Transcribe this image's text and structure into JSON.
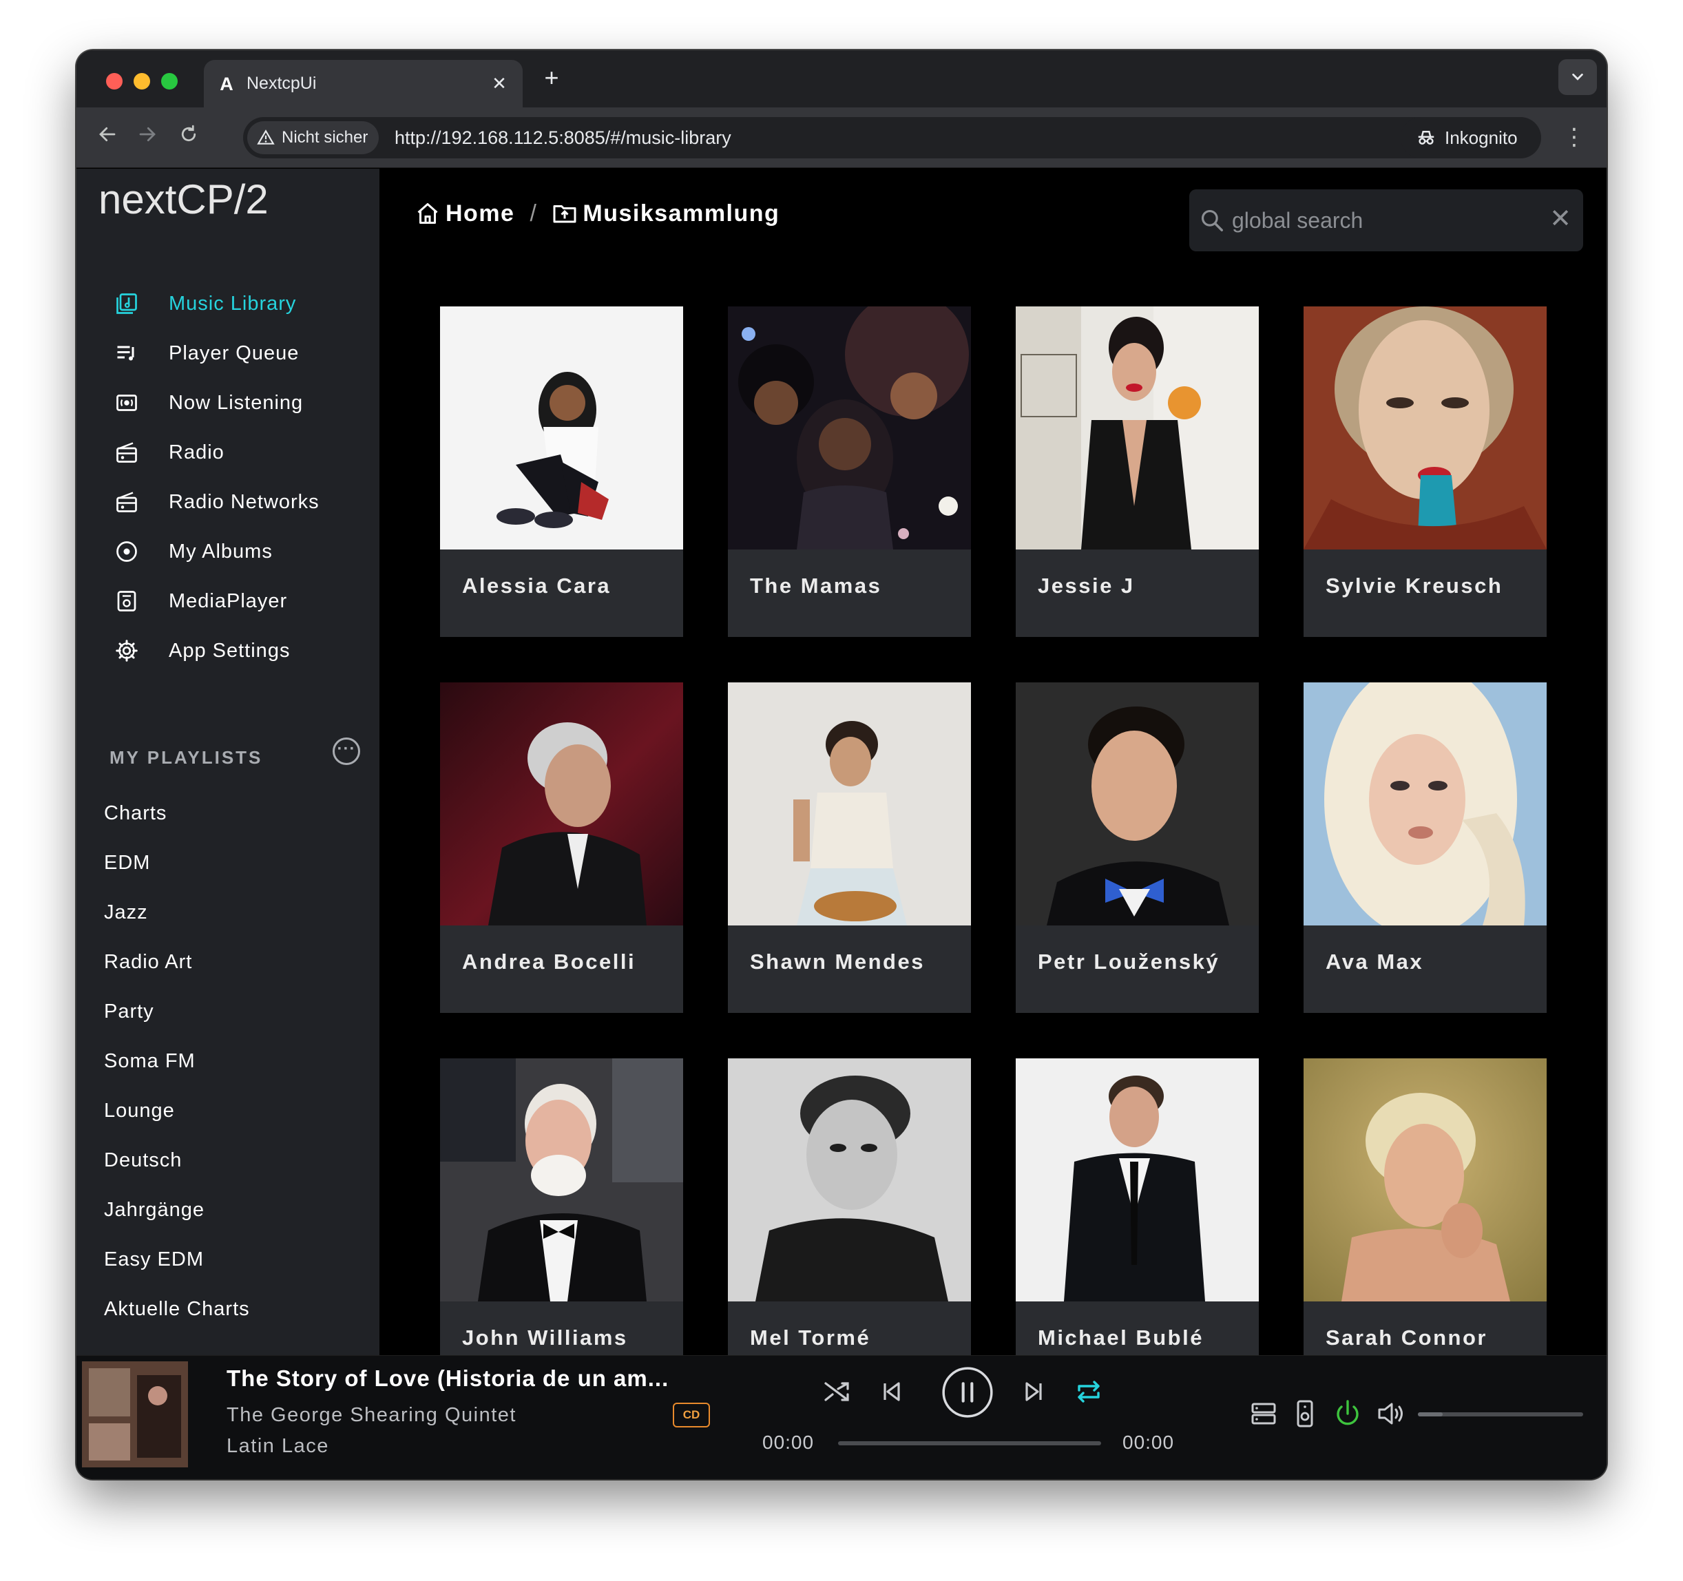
{
  "browser": {
    "tab_title": "NextcpUi",
    "tab_favicon": "A",
    "security_label": "Nicht sicher",
    "url": "http://192.168.112.5:8085/#/music-library",
    "profile_label": "Inkognito"
  },
  "app": {
    "logo": "nextCP/2",
    "nav": [
      {
        "label": "Music Library",
        "icon": "music-library-icon",
        "active": true
      },
      {
        "label": "Player Queue",
        "icon": "queue-icon",
        "active": false
      },
      {
        "label": "Now Listening",
        "icon": "now-listening-icon",
        "active": false
      },
      {
        "label": "Radio",
        "icon": "radio-icon",
        "active": false
      },
      {
        "label": "Radio Networks",
        "icon": "radio-icon",
        "active": false
      },
      {
        "label": "My Albums",
        "icon": "disc-icon",
        "active": false
      },
      {
        "label": "MediaPlayer",
        "icon": "mediaplayer-icon",
        "active": false
      },
      {
        "label": "App Settings",
        "icon": "gear-icon",
        "active": false
      }
    ],
    "playlists_heading": "MY PLAYLISTS",
    "playlists": [
      "Charts",
      "EDM",
      "Jazz",
      "Radio Art",
      "Party",
      "Soma FM",
      "Lounge",
      "Deutsch",
      "Jahrgänge",
      "Easy EDM",
      "Aktuelle Charts"
    ]
  },
  "breadcrumb": {
    "home": "Home",
    "current": "Musiksammlung"
  },
  "search": {
    "placeholder": "global search",
    "value": ""
  },
  "artists": [
    {
      "name": "Alessia Cara"
    },
    {
      "name": "The Mamas"
    },
    {
      "name": "Jessie J"
    },
    {
      "name": "Sylvie Kreusch"
    },
    {
      "name": "Andrea Bocelli"
    },
    {
      "name": "Shawn Mendes"
    },
    {
      "name": "Petr Louženský"
    },
    {
      "name": "Ava Max"
    },
    {
      "name": "John Williams"
    },
    {
      "name": "Mel Tormé"
    },
    {
      "name": "Michael Bublé"
    },
    {
      "name": "Sarah Connor"
    }
  ],
  "player": {
    "title": "The Story of Love (Historia de un am...",
    "artist": "The George Shearing Quintet",
    "album": "Latin Lace",
    "badge": "CD",
    "elapsed": "00:00",
    "duration": "00:00",
    "progress": 0,
    "volume": 0.15,
    "colors": {
      "accent": "#26d3dd",
      "power": "#3ec43e",
      "badge": "#e88a2c"
    }
  }
}
